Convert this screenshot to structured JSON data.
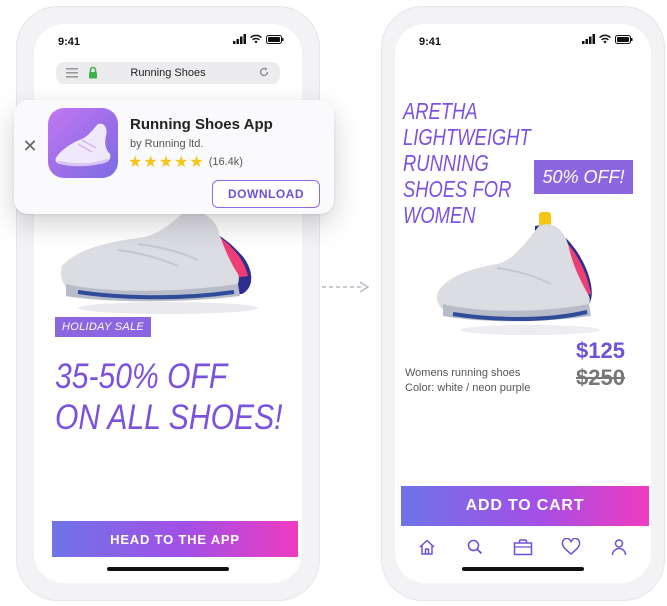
{
  "colors": {
    "accent": "#7b52e0",
    "tag": "#8c65e0",
    "star": "#f5c518",
    "gradient_start": "#6f74e8",
    "gradient_end": "#ef3cc0"
  },
  "left_phone": {
    "status_time": "9:41",
    "url_title": "Running Shoes",
    "sale_tag": "HOLIDAY SALE",
    "promo_line1": "35-50% OFF",
    "promo_line2": "ON ALL SHOES!",
    "cta_label": "HEAD TO THE APP"
  },
  "app_banner": {
    "close_icon": "close-icon",
    "app_name": "Running Shoes App",
    "publisher": "by Running ltd.",
    "rating": 5,
    "rating_count": "(16.4k)",
    "download_label": "DOWNLOAD"
  },
  "right_phone": {
    "status_time": "9:41",
    "title_lines": [
      "ARETHA",
      "LIGHTWEIGHT",
      "RUNNING",
      "SHOES FOR",
      "WOMEN"
    ],
    "discount": "50% OFF!",
    "description_line1": "Womens running shoes",
    "description_line2": "Color: white / neon purple",
    "price": "$125",
    "old_price": "$250",
    "add_to_cart": "ADD TO CART",
    "tabs": [
      {
        "icon": "home-icon"
      },
      {
        "icon": "search-icon"
      },
      {
        "icon": "shopping-bag-icon"
      },
      {
        "icon": "heart-icon"
      },
      {
        "icon": "user-icon"
      }
    ]
  }
}
